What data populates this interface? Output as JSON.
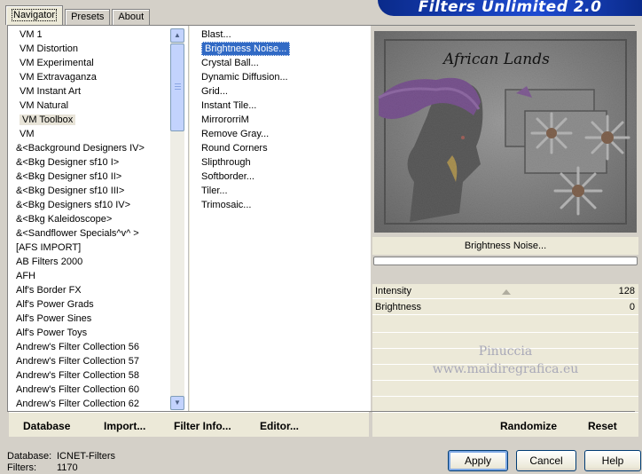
{
  "window": {
    "banner_title": "Filters Unlimited 2.0"
  },
  "tabs": [
    {
      "label": "Navigator",
      "active": true
    },
    {
      "label": "Presets",
      "active": false
    },
    {
      "label": "About",
      "active": false
    }
  ],
  "categories": {
    "selected": "VM Toolbox",
    "items": [
      "VM 1",
      "VM Distortion",
      "VM Experimental",
      "VM Extravaganza",
      "VM Instant Art",
      "VM Natural",
      "VM Toolbox",
      "VM",
      "&<Background Designers IV>",
      "&<Bkg Designer sf10 I>",
      "&<Bkg Designer sf10 II>",
      "&<Bkg Designer sf10 III>",
      "&<Bkg Designers sf10 IV>",
      "&<Bkg Kaleidoscope>",
      "&<Sandflower Specials^v^ >",
      "[AFS IMPORT]",
      "AB Filters 2000",
      "AFH",
      "Alf's Border FX",
      "Alf's Power Grads",
      "Alf's Power Sines",
      "Alf's Power Toys",
      "Andrew's Filter Collection 56",
      "Andrew's Filter Collection 57",
      "Andrew's Filter Collection 58",
      "Andrew's Filter Collection 60",
      "Andrew's Filter Collection 62"
    ]
  },
  "filters": {
    "selected": "Brightness Noise...",
    "items": [
      "Blast...",
      "Brightness Noise...",
      "Crystal Ball...",
      "Dynamic Diffusion...",
      "Grid...",
      "Instant Tile...",
      "MirrororriM",
      "Remove Gray...",
      "Round Corners",
      "Slipthrough",
      "Softborder...",
      "Tiler...",
      "Trimosaic..."
    ]
  },
  "preview": {
    "title": "Brightness Noise...",
    "image_caption": "African Lands",
    "watermark_line1": "Pinuccia",
    "watermark_line2": "www.maidiregrafica.eu"
  },
  "parameters": [
    {
      "label": "Intensity",
      "value": "128"
    },
    {
      "label": "Brightness",
      "value": "0"
    }
  ],
  "bottom_links": {
    "database": "Database",
    "import": "Import...",
    "filter_info": "Filter Info...",
    "editor": "Editor...",
    "randomize": "Randomize",
    "reset": "Reset"
  },
  "status": {
    "database_label": "Database:",
    "database_value": "ICNET-Filters",
    "filters_label": "Filters:",
    "filters_value": "1170"
  },
  "buttons": {
    "apply": "Apply",
    "cancel": "Cancel",
    "help": "Help"
  },
  "colors": {
    "accent": "#316ac5",
    "banner": "#1e4bd1",
    "purple_headwrap": "#6a1b9a"
  }
}
